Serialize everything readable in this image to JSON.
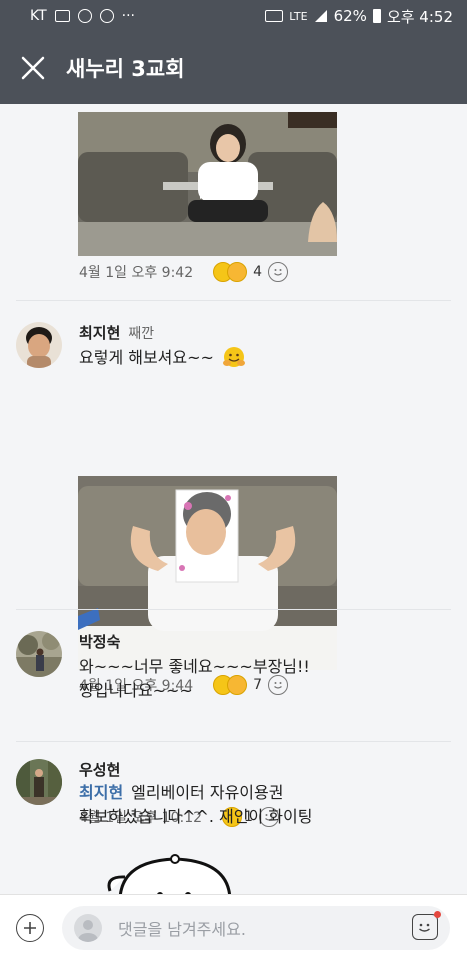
{
  "status_bar": {
    "carrier": "KT",
    "network": "LTE",
    "battery": "62%",
    "time": "오후 4:52"
  },
  "header": {
    "title": "새누리 3교회"
  },
  "posts": [
    {
      "time": "4월 1일 오후 9:42",
      "reaction_count": "4"
    },
    {
      "author": "최지현",
      "role": "째깐",
      "text": "요렇게 해보셔요~~",
      "time": "4월 1일 오후 9:44",
      "reaction_count": "7"
    },
    {
      "author": "박정숙",
      "text_line1": "와~~~너무 좋네요~~~부장님!!",
      "text_line2": "짱입니다요~~~",
      "time": "4월 1일 오후 10:12",
      "reaction_count": "1"
    },
    {
      "author": "우성현",
      "mention": "최지현",
      "text_line1": "엘리베이터 자유이용권",
      "text_line2": "확보하셨습니다^^. 재인이 화이팅"
    }
  ],
  "composer": {
    "placeholder": "댓글을 남겨주세요."
  },
  "colors": {
    "header_bg": "#4c5159",
    "feed_bg": "#f4f5f7",
    "mention": "#3c6ea8"
  }
}
